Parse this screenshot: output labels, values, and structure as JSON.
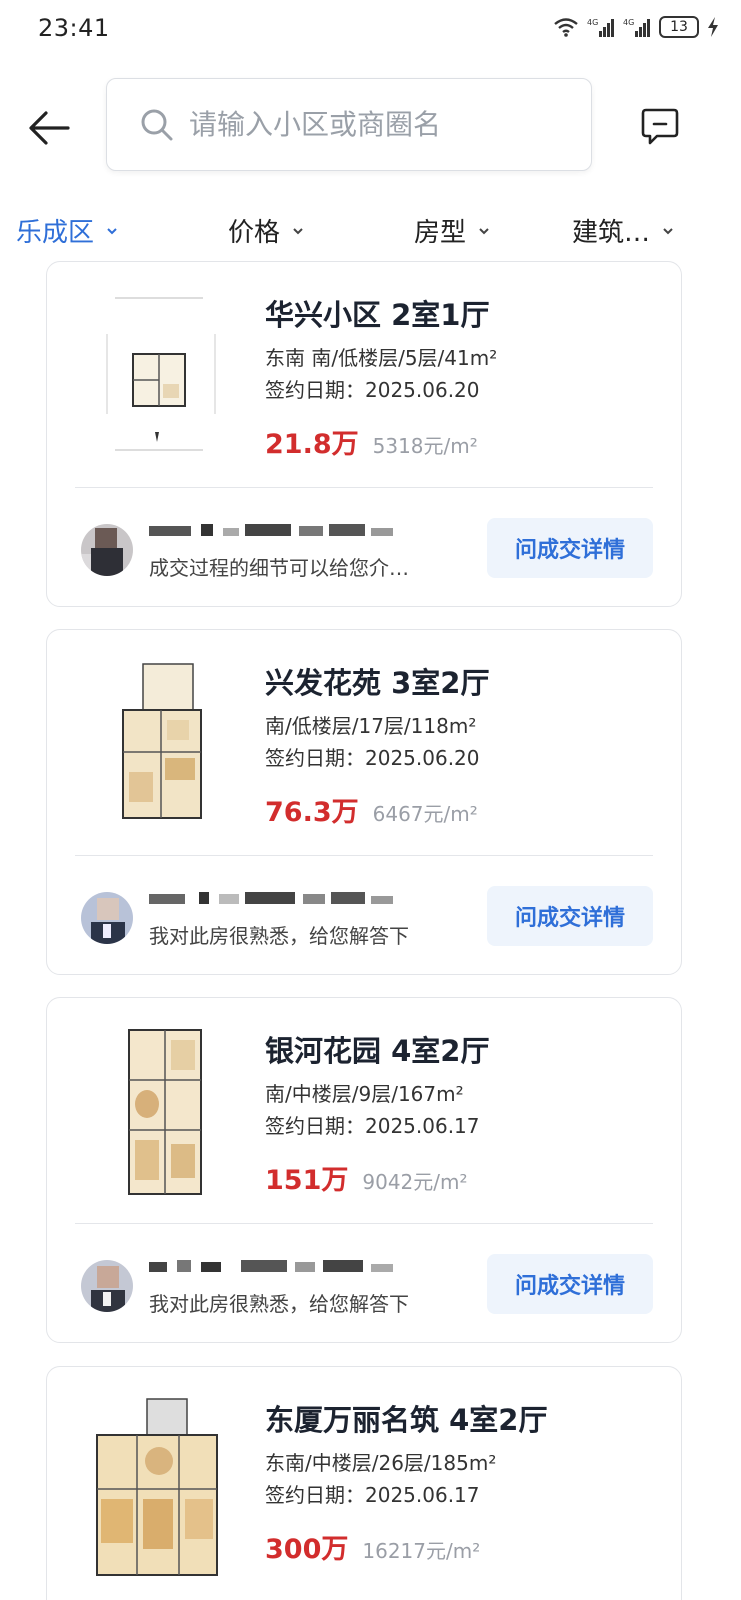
{
  "status": {
    "time": "23:41",
    "battery": "13"
  },
  "search": {
    "placeholder": "请输入小区或商圈名"
  },
  "filters": [
    {
      "label": "乐成区",
      "active": true
    },
    {
      "label": "价格",
      "active": false
    },
    {
      "label": "房型",
      "active": false
    },
    {
      "label": "建筑…",
      "active": false
    }
  ],
  "listings": [
    {
      "title": "华兴小区 2室1厅",
      "spec": "东南 南/低楼层/5层/41m²",
      "sign_date": "签约日期：2025.06.20",
      "price": "21.8万",
      "unit_price": "5318元/m²",
      "agent_message": "成交过程的细节可以给您介…",
      "button_label": "问成交详情"
    },
    {
      "title": "兴发花苑 3室2厅",
      "spec": "南/低楼层/17层/118m²",
      "sign_date": "签约日期：2025.06.20",
      "price": "76.3万",
      "unit_price": "6467元/m²",
      "agent_message": "我对此房很熟悉，给您解答下",
      "button_label": "问成交详情"
    },
    {
      "title": "银河花园 4室2厅",
      "spec": "南/中楼层/9层/167m²",
      "sign_date": "签约日期：2025.06.17",
      "price": "151万",
      "unit_price": "9042元/m²",
      "agent_message": "我对此房很熟悉，给您解答下",
      "button_label": "问成交详情"
    },
    {
      "title": "东厦万丽名筑 4室2厅",
      "spec": "东南/中楼层/26层/185m²",
      "sign_date": "签约日期：2025.06.17",
      "price": "300万",
      "unit_price": "16217元/m²",
      "agent_message": "",
      "button_label": ""
    }
  ],
  "colors": {
    "accent": "#2f6fd8",
    "price": "#d22d2d",
    "button_bg": "#eef4fc"
  },
  "icons": [
    "back-arrow-icon",
    "search-icon",
    "message-icon",
    "chevron-down-icon",
    "wifi-icon",
    "signal-icon",
    "charging-icon"
  ]
}
